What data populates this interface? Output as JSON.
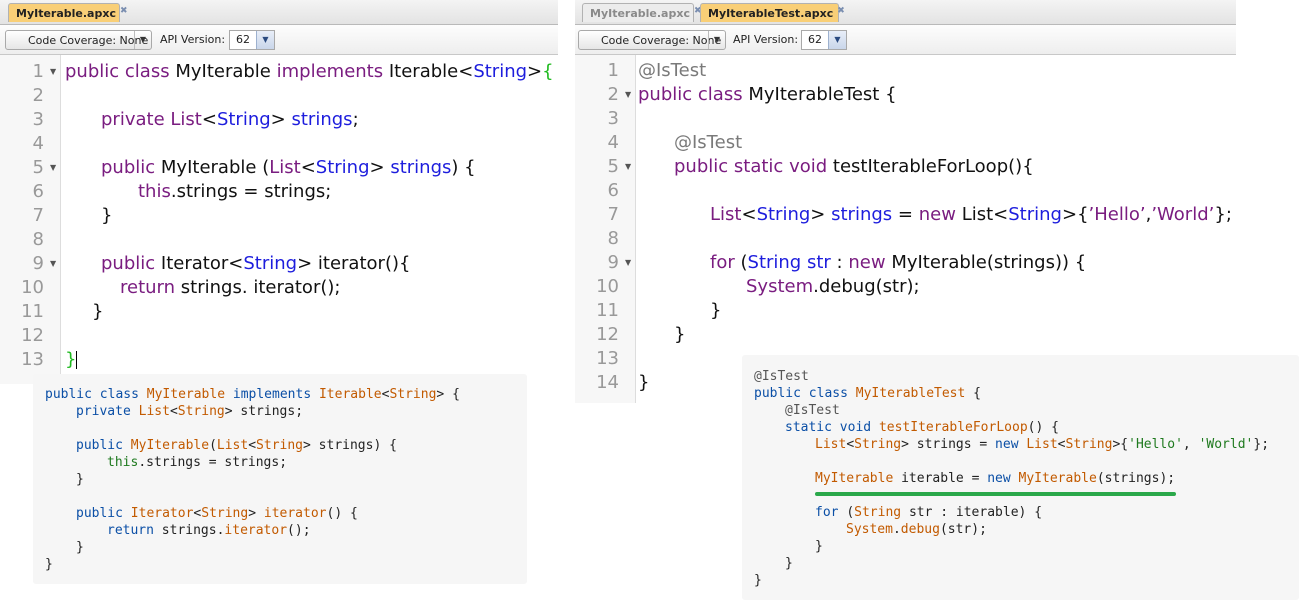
{
  "left_window": {
    "tabs": [
      {
        "label": "MyIterable.apxc"
      }
    ],
    "toolbar": {
      "coverage": "Code Coverage: None",
      "api_label": "API Version:",
      "api_value": "62"
    },
    "lines": [
      "1",
      "2",
      "3",
      "4",
      "5",
      "6",
      "7",
      "8",
      "9",
      "10",
      "11",
      "12",
      "13"
    ]
  },
  "right_window": {
    "tabs": [
      {
        "label": "MyIterable.apxc"
      },
      {
        "label": "MyIterableTest.apxc"
      }
    ],
    "toolbar": {
      "coverage": "Code Coverage: None",
      "api_label": "API Version:",
      "api_value": "62"
    },
    "lines": [
      "1",
      "2",
      "3",
      "4",
      "5",
      "6",
      "7",
      "8",
      "9",
      "10",
      "11",
      "12",
      "13",
      "14"
    ]
  },
  "code": {
    "public": "public",
    "class": "class",
    "implements": "implements",
    "private": "private",
    "static": "static",
    "void": "void",
    "this": "this",
    "return": "return",
    "new": "new",
    "for": "for",
    "MyIterable": "MyIterable",
    "MyIterableTest": "MyIterableTest",
    "Iterable": "Iterable",
    "Iterator": "Iterator",
    "List": "List",
    "String": "String",
    "System": "System",
    "strings": "strings",
    "str": "str",
    "iterable": "iterable",
    "IsTest": "@IsTest",
    "testIterableForLoop": "testIterableForLoop",
    "iterator": "iterator",
    "debug": "debug",
    "hello_q": "'Hello'",
    "world_q": "'World'",
    "hello_r": "’Hello’",
    "world_r": "’World’",
    "lt": "<",
    "gt": ">",
    "lbrace": "{",
    "rbrace": "}",
    "semi": ";",
    "eq": "=",
    "dot": ".",
    "paren_l": "(",
    "paren_r": ")",
    "colon": ":",
    "comma": ","
  }
}
